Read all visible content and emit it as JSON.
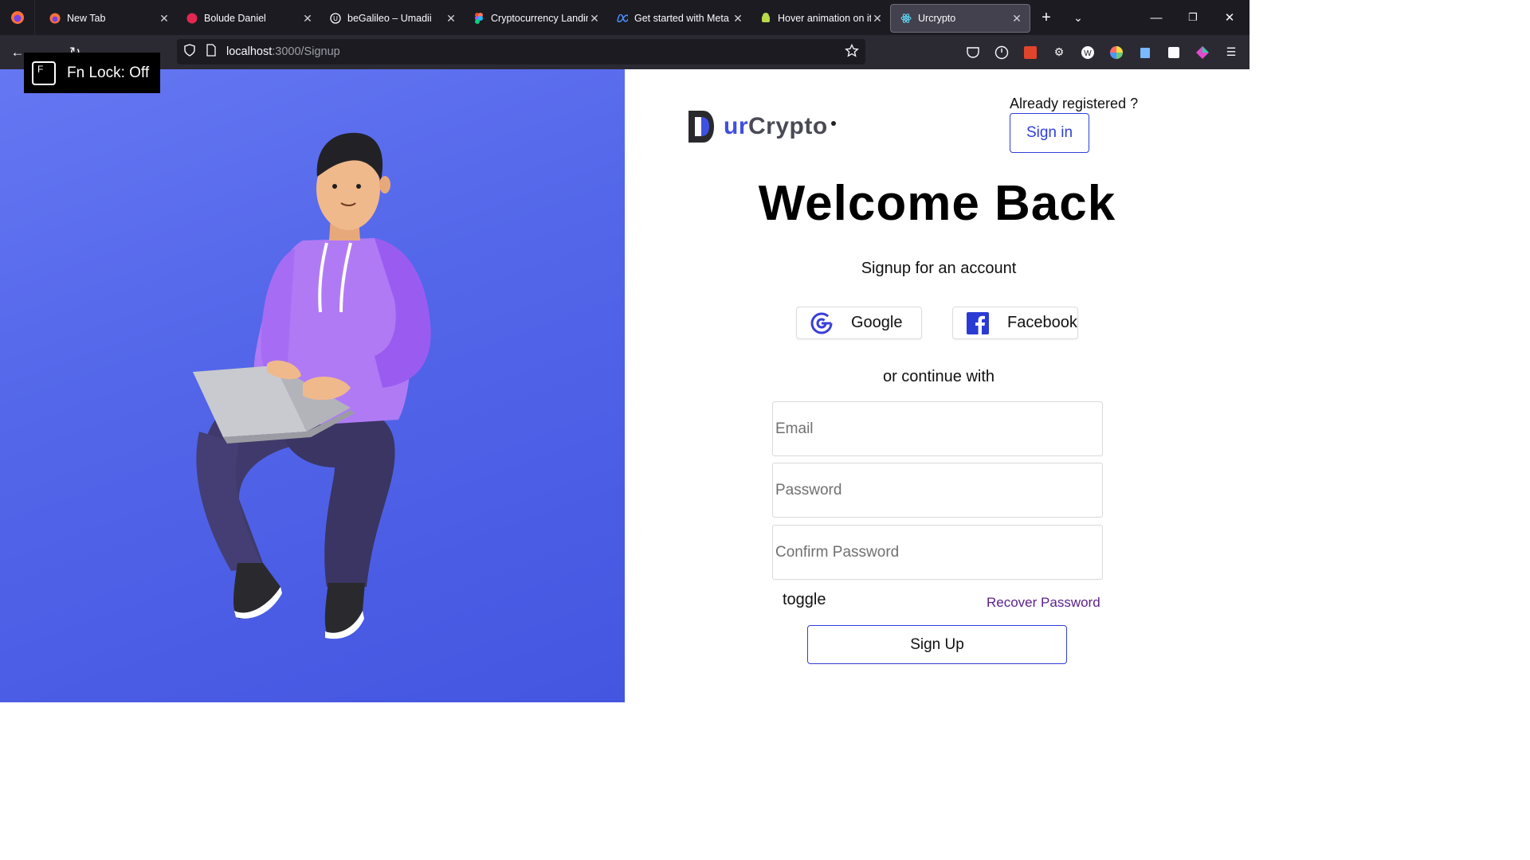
{
  "browser": {
    "tabs": [
      {
        "title": "New Tab",
        "icon": "firefox-icon"
      },
      {
        "title": "Bolude Daniel",
        "icon": "red-dot-icon"
      },
      {
        "title": "beGalileo – Umadii",
        "icon": "u-logo-icon"
      },
      {
        "title": "Cryptocurrency Landin",
        "icon": "figma-icon"
      },
      {
        "title": "Get started with Meta",
        "icon": "meta-icon"
      },
      {
        "title": "Hover animation on it",
        "icon": "android-icon"
      },
      {
        "title": "Urcrypto",
        "icon": "react-icon"
      }
    ],
    "active_tab": 6,
    "url_host": "localhost",
    "url_path": ":3000/Signup"
  },
  "fn_lock": {
    "key": "F",
    "text": "Fn Lock: Off"
  },
  "brand": {
    "prefix": "ur",
    "suffix": "Crypto"
  },
  "header": {
    "already": "Already registered ?",
    "signin": "Sign in"
  },
  "main": {
    "title": "Welcome Back",
    "subtitle": "Signup for an account",
    "google": "Google",
    "facebook": "Facebook",
    "or_continue": "or continue with",
    "email_placeholder": "Email",
    "password_placeholder": "Password",
    "confirm_placeholder": "Confirm Password",
    "toggle": "toggle",
    "recover": "Recover Password",
    "signup": "Sign Up"
  },
  "colors": {
    "accent": "#2e3fd8",
    "panel": "#5467ea",
    "recover": "#5a1f8c"
  }
}
